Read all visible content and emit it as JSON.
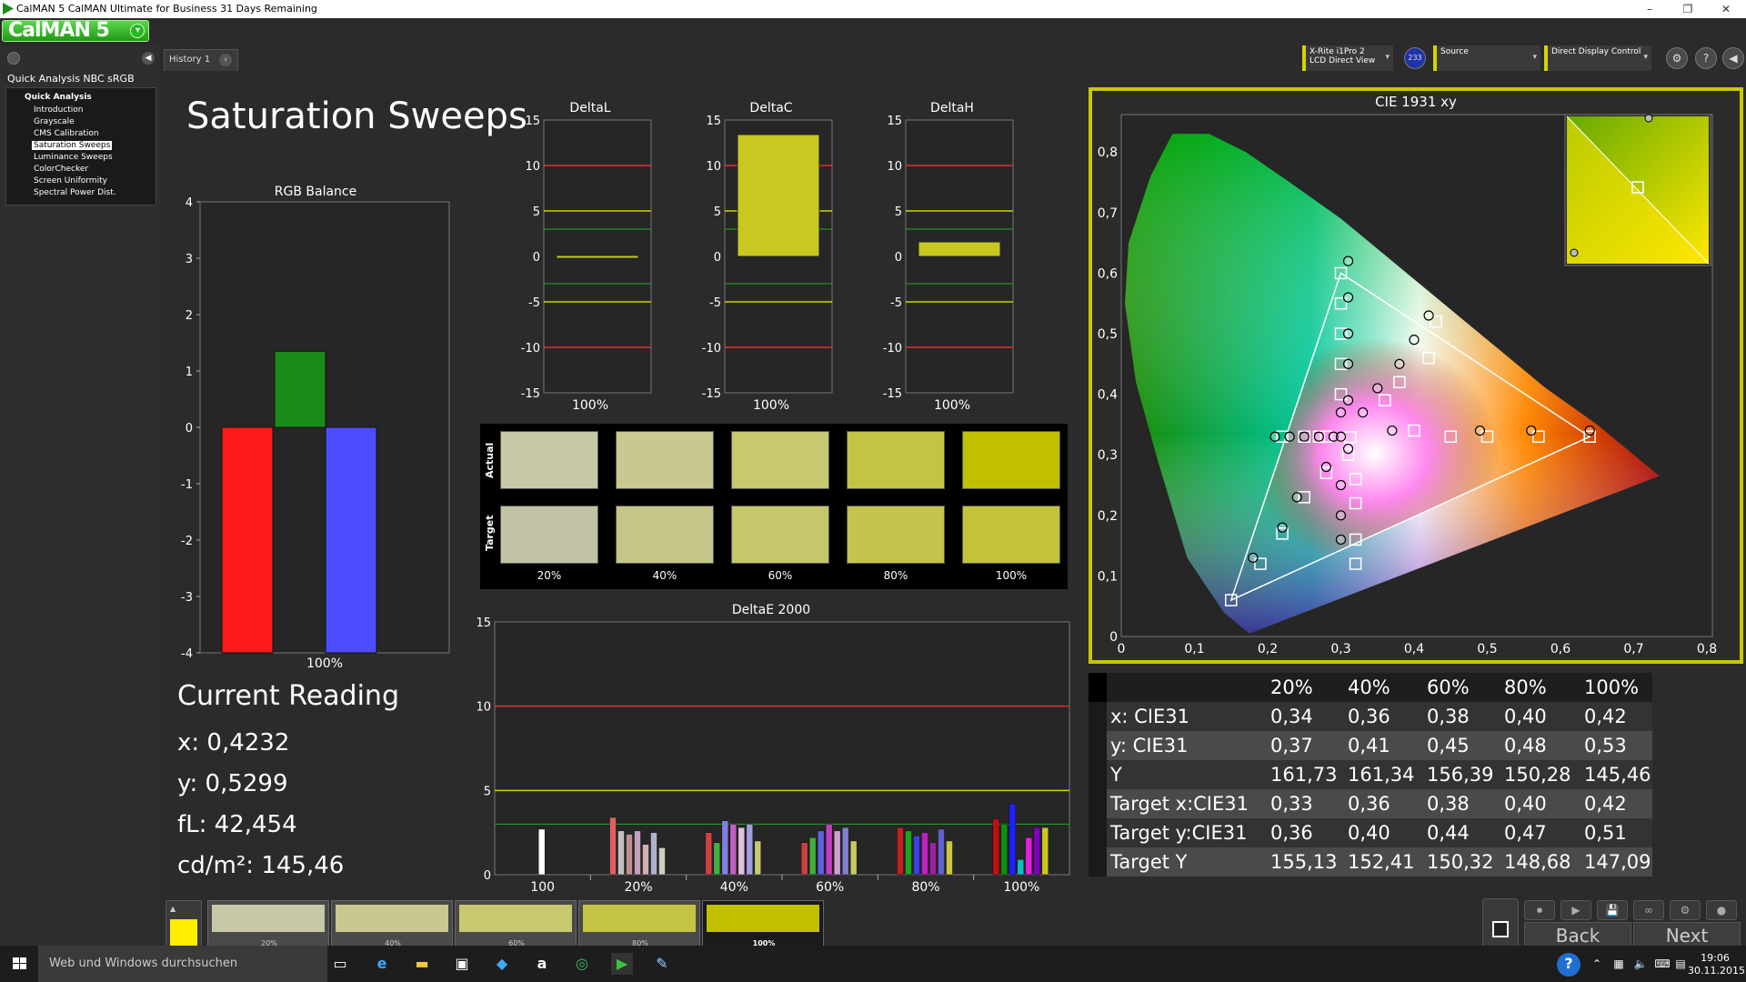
{
  "window": {
    "title": "CalMAN 5 CalMAN Ultimate for Business 31 Days Remaining",
    "logo": "CalMAN 5"
  },
  "sidebar": {
    "workflow": "Quick Analysis NBC sRGB",
    "group": "Quick Analysis",
    "items": [
      "Introduction",
      "Grayscale",
      "CMS Calibration",
      "Saturation Sweeps",
      "Luminance Sweeps",
      "ColorChecker",
      "Screen Uniformity",
      "Spectral Power Dist."
    ],
    "selected": "Saturation Sweeps"
  },
  "tabs": {
    "history": "History 1"
  },
  "devices": {
    "meter_line1": "X-Rite i1Pro 2",
    "meter_line2": "LCD Direct View",
    "meter_badge": "233",
    "source": "Source",
    "display": "Direct Display Control"
  },
  "page": {
    "title": "Saturation Sweeps"
  },
  "rgb_balance": {
    "title": "RGB Balance",
    "xlabel": "100%",
    "yticks": [
      "4",
      "3",
      "2",
      "1",
      "0",
      "-1",
      "-2",
      "-3",
      "-4"
    ],
    "values": {
      "red": -4,
      "green": 1.35,
      "blue": -4
    },
    "colors": {
      "red": "#ff1a1a",
      "green": "#1a8a1a",
      "blue": "#4d4dff"
    }
  },
  "delta_charts": [
    {
      "title": "DeltaL",
      "xlabel": "100%",
      "value": -0.1
    },
    {
      "title": "DeltaC",
      "xlabel": "100%",
      "value": 13.4
    },
    {
      "title": "DeltaH",
      "xlabel": "100%",
      "value": 1.6
    }
  ],
  "delta_yticks": [
    "15",
    "10",
    "5",
    "0",
    "-5",
    "-10",
    "-15"
  ],
  "swatches": {
    "actual_label": "Actual",
    "target_label": "Target",
    "levels": [
      "20%",
      "40%",
      "60%",
      "80%",
      "100%"
    ],
    "actual": [
      "#c8c8a8",
      "#c8c890",
      "#c8c870",
      "#c4c444",
      "#c0c000"
    ],
    "target": [
      "#c2c2a4",
      "#c6c68a",
      "#c6c66a",
      "#c4c44e",
      "#c4c43a"
    ]
  },
  "deltae": {
    "title": "DeltaE 2000",
    "yticks": [
      "15",
      "10",
      "5",
      "0"
    ],
    "xlabels": [
      "100",
      "20%",
      "40%",
      "60%",
      "80%",
      "100%"
    ]
  },
  "reading": {
    "title": "Current Reading",
    "x": "x: 0,4232",
    "y": "y: 0,5299",
    "fL": "fL: 42,454",
    "cdm2": "cd/m²: 145,46"
  },
  "cie": {
    "title": "CIE 1931 xy",
    "xticks": [
      "0",
      "0,1",
      "0,2",
      "0,3",
      "0,4",
      "0,5",
      "0,6",
      "0,7",
      "0,8"
    ],
    "yticks": [
      "0,8",
      "0,7",
      "0,6",
      "0,5",
      "0,4",
      "0,3",
      "0,2",
      "0,1",
      "0"
    ]
  },
  "table": {
    "headers": [
      "20%",
      "40%",
      "60%",
      "80%",
      "100%"
    ],
    "rows": [
      {
        "label": "x: CIE31",
        "values": [
          "0,34",
          "0,36",
          "0,38",
          "0,40",
          "0,42"
        ]
      },
      {
        "label": "y: CIE31",
        "values": [
          "0,37",
          "0,41",
          "0,45",
          "0,48",
          "0,53"
        ]
      },
      {
        "label": "Y",
        "values": [
          "161,73",
          "161,34",
          "156,39",
          "150,28",
          "145,46"
        ]
      },
      {
        "label": "Target x:CIE31",
        "values": [
          "0,33",
          "0,36",
          "0,38",
          "0,40",
          "0,42"
        ]
      },
      {
        "label": "Target y:CIE31",
        "values": [
          "0,36",
          "0,40",
          "0,44",
          "0,47",
          "0,51"
        ]
      },
      {
        "label": "Target Y",
        "values": [
          "155,13",
          "152,41",
          "150,32",
          "148,68",
          "147,09"
        ]
      }
    ]
  },
  "bottom": {
    "swatch_labels": [
      "20%",
      "40%",
      "60%",
      "80%",
      "100%"
    ],
    "back": "Back",
    "next": "Next"
  },
  "taskbar": {
    "search": "Web und Windows durchsuchen",
    "time": "19:06",
    "date": "30.11.2015"
  }
}
